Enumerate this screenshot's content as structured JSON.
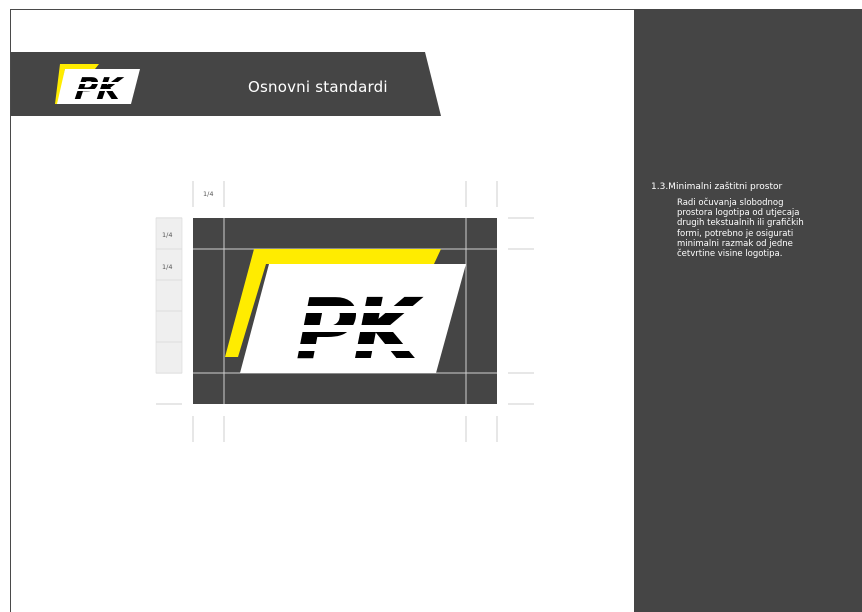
{
  "header": {
    "title": "Osnovni standardi",
    "logo_text": "PK"
  },
  "diagram": {
    "quarter_top": "1/4",
    "quarter_left_1": "1/4",
    "quarter_left_2": "1/4",
    "logo_text": "PK"
  },
  "side_panel": {
    "section_number": "1.3.",
    "section_title": "Minimalni zaštitni prostor",
    "section_heading": "1.3.Minimalni zaštitni prostor",
    "body": "Radi očuvanja slobodnog prostora logotipa od utjecaja drugih tekstualnih ili grafičkih formi, potrebno je osigurati minimalni razmak od jedne četvrtine visine logotipa."
  },
  "colors": {
    "dark_gray": "#454545",
    "brand_yellow": "#ffec00",
    "white": "#ffffff",
    "black": "#000000"
  }
}
